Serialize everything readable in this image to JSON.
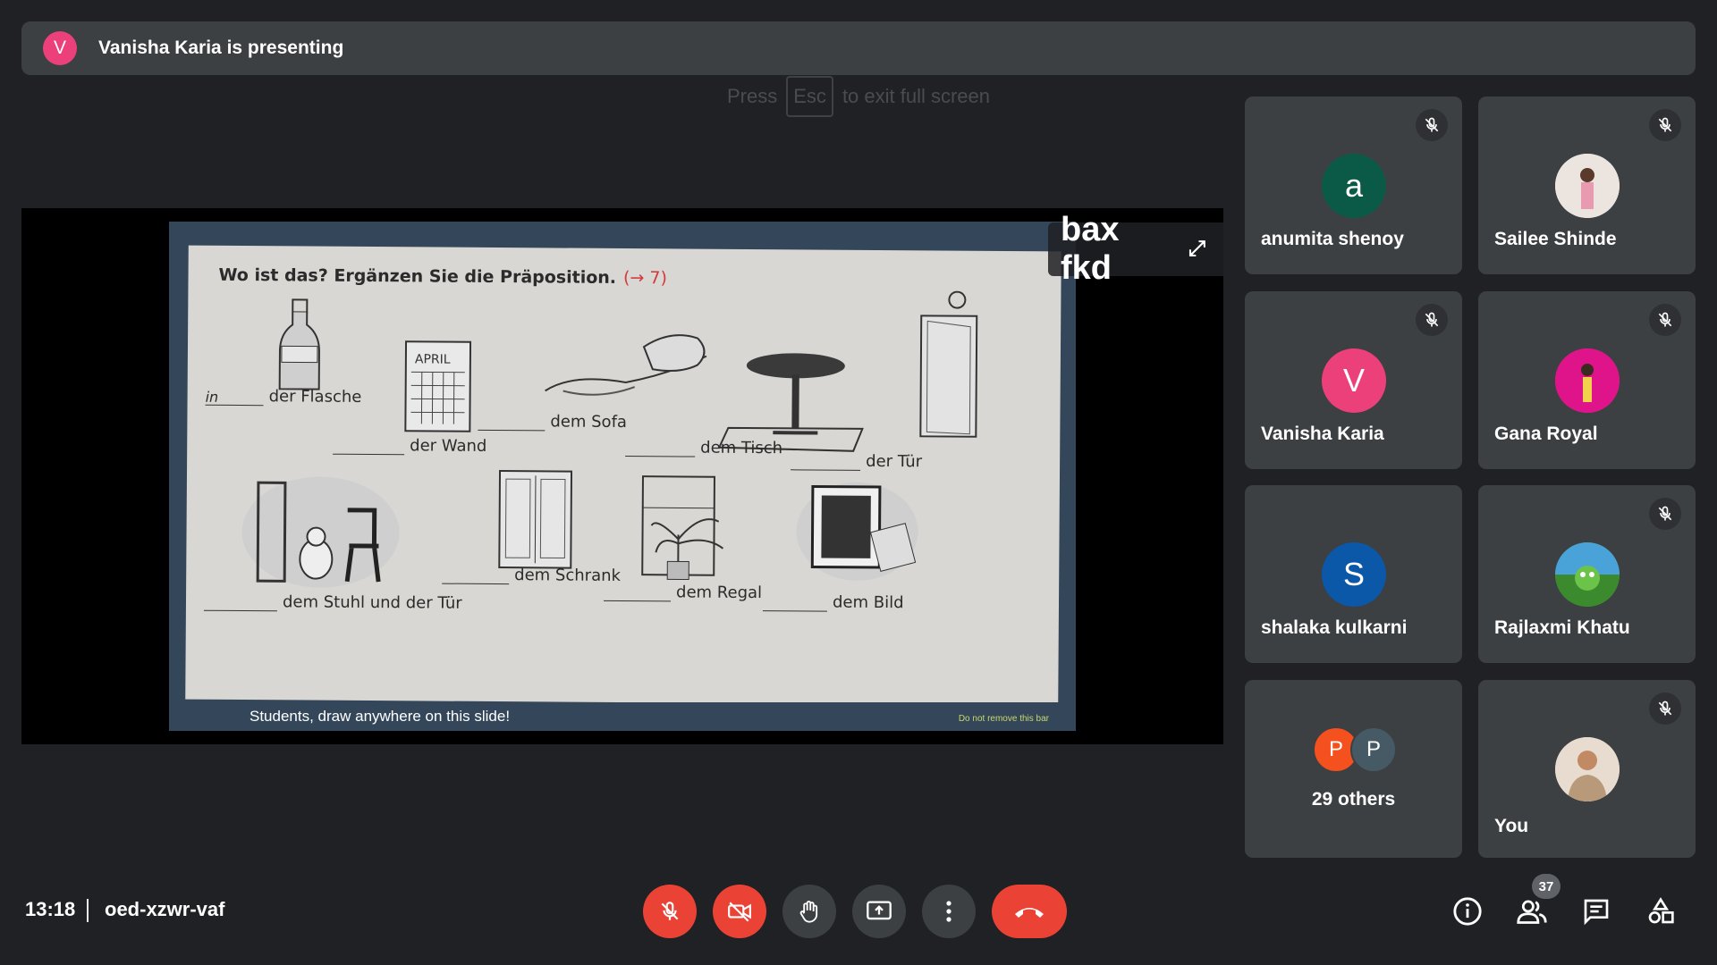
{
  "banner": {
    "avatar_letter": "V",
    "text": "Vanisha Karia is presenting"
  },
  "esc_hint": {
    "before": "Press",
    "key": "Esc",
    "after": "to exit full screen"
  },
  "presentation": {
    "heading": "Wo ist das? Ergänzen Sie die Präposition.",
    "heading_ref": "(→ 7)",
    "exercises": [
      {
        "blank": "in",
        "text": "der Flasche"
      },
      {
        "blank": "",
        "text": "der Wand"
      },
      {
        "blank": "",
        "text": "dem Sofa"
      },
      {
        "blank": "",
        "text": "dem Tisch"
      },
      {
        "blank": "",
        "text": "der Tür"
      },
      {
        "blank": "",
        "text": "dem Stuhl und der Tür"
      },
      {
        "blank": "",
        "text": "dem Schrank"
      },
      {
        "blank": "",
        "text": "dem Regal"
      },
      {
        "blank": "",
        "text": "dem Bild"
      }
    ],
    "calendar_label": "APRIL",
    "bar_message": "Students, draw anywhere on this slide!",
    "bar_note": "Do not remove this bar",
    "presenter_name": "bax fkd"
  },
  "participants": [
    {
      "name": "anumita shenoy",
      "initial": "a",
      "color": "#0b5a47",
      "muted": true
    },
    {
      "name": "Sailee Shinde",
      "initial": "",
      "color": "#e9e2dc",
      "muted": true
    },
    {
      "name": "Vanisha Karia",
      "initial": "V",
      "color": "#ec407a",
      "muted": true
    },
    {
      "name": "Gana Royal",
      "initial": "",
      "color": "#e91e8c",
      "muted": true
    },
    {
      "name": "shalaka kulkarni",
      "initial": "S",
      "color": "#0b57a8",
      "muted": false
    },
    {
      "name": "Rajlaxmi Khatu",
      "initial": "",
      "color": "#3e8e3e",
      "muted": true
    },
    {
      "name": "You",
      "initial": "",
      "color": "#d8c7b5",
      "muted": true
    }
  ],
  "others": {
    "label": "29 others",
    "avatars": [
      {
        "initial": "P",
        "color": "#f4511e"
      },
      {
        "initial": "P",
        "color": "#455a64"
      }
    ]
  },
  "bottom": {
    "time": "13:18",
    "meeting_code": "oed-xzwr-vaf",
    "people_count": "37",
    "icons": [
      "mic-off-icon",
      "camera-off-icon",
      "raise-hand-icon",
      "present-icon",
      "more-icon",
      "end-call-icon",
      "info-icon",
      "people-icon",
      "chat-icon",
      "activities-icon"
    ]
  }
}
